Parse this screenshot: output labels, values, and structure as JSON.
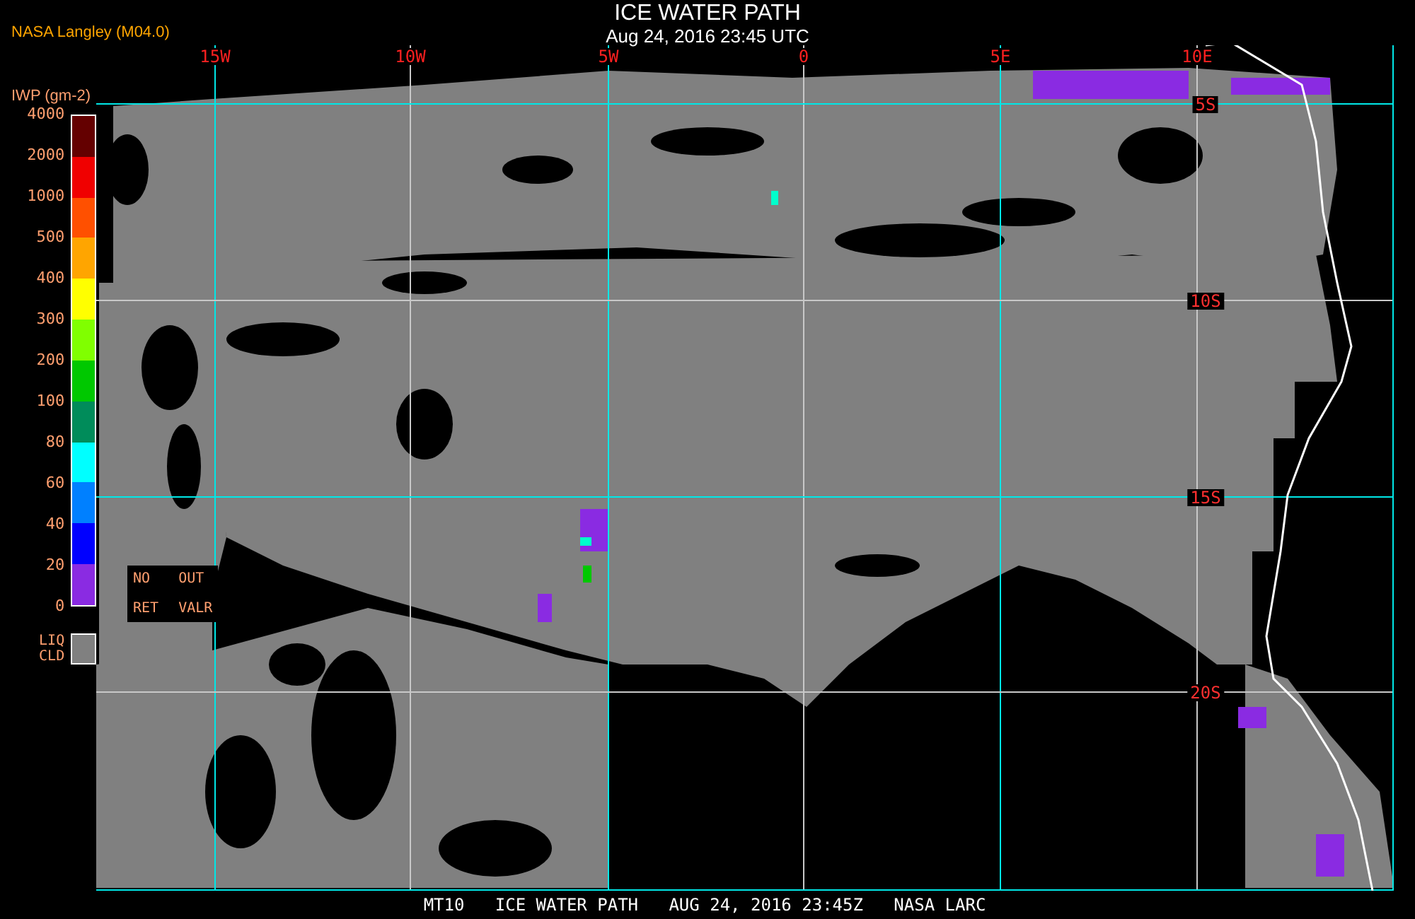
{
  "header": {
    "title": "ICE WATER PATH",
    "subtitle": "Aug 24, 2016 23:45 UTC",
    "source": "NASA Langley (M04.0)"
  },
  "legend": {
    "title": "IWP (gm-2)",
    "ticks": [
      "4000",
      "2000",
      "1000",
      "500",
      "400",
      "300",
      "200",
      "100",
      "80",
      "60",
      "40",
      "20",
      "0"
    ],
    "bins": [
      {
        "color": "#640000"
      },
      {
        "color": "#f00000"
      },
      {
        "color": "#ff5000"
      },
      {
        "color": "#ffa500"
      },
      {
        "color": "#ffff00"
      },
      {
        "color": "#80ff00"
      },
      {
        "color": "#00c800"
      },
      {
        "color": "#008c5a"
      },
      {
        "color": "#00ffff"
      },
      {
        "color": "#0080ff"
      },
      {
        "color": "#0000ff"
      },
      {
        "color": "#8a2be2"
      }
    ],
    "notes": [
      [
        "NO",
        "OUT"
      ],
      [
        "RET",
        "VALR"
      ]
    ],
    "liquid_cloud": [
      "LIQ",
      "CLD"
    ]
  },
  "map": {
    "longitude_labels": [
      "15W",
      "10W",
      "5W",
      "0",
      "5E",
      "10E"
    ],
    "latitude_labels": [
      "5S",
      "10S",
      "15S",
      "20S"
    ]
  },
  "footer": "MT10   ICE WATER PATH   AUG 24, 2016 23:45Z   NASA LARC"
}
